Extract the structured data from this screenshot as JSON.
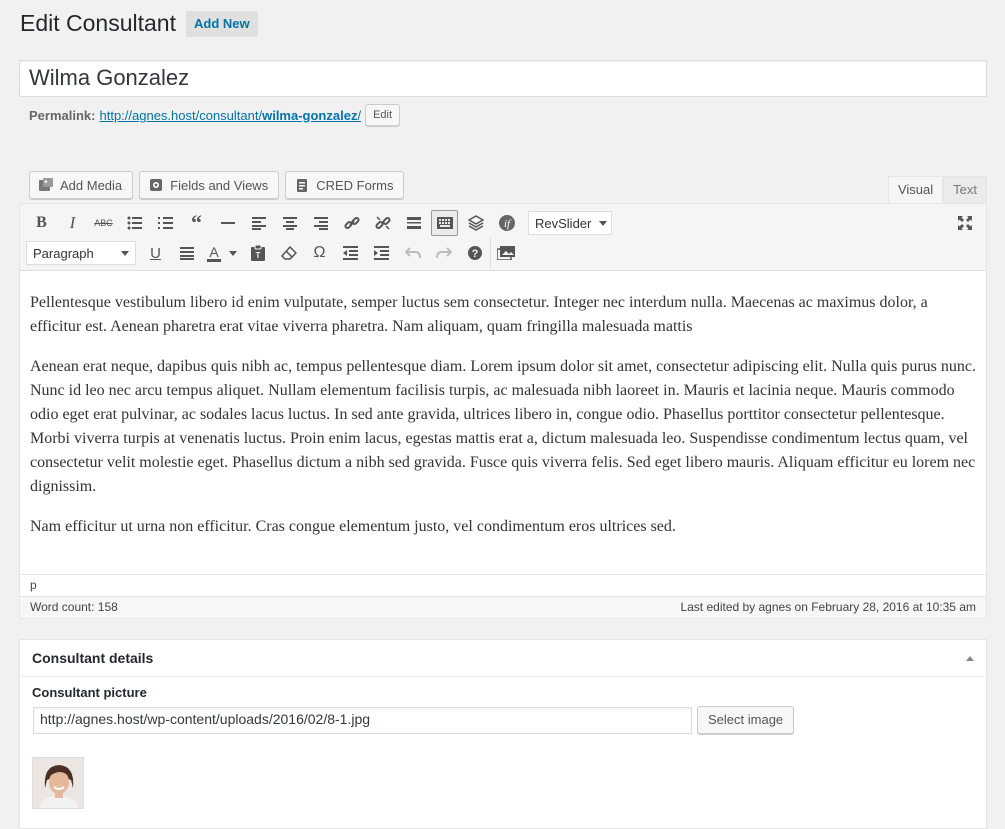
{
  "header": {
    "title": "Edit Consultant",
    "add_new": "Add New"
  },
  "post": {
    "title": "Wilma Gonzalez",
    "permalink_label": "Permalink:",
    "permalink_base": "http://agnes.host/consultant/",
    "permalink_slug": "wilma-gonzalez",
    "permalink_trailing": "/",
    "edit_label": "Edit"
  },
  "media_buttons": [
    {
      "label": "Add Media",
      "icon": "add-media-icon"
    },
    {
      "label": "Fields and Views",
      "icon": "fields-views-icon"
    },
    {
      "label": "CRED Forms",
      "icon": "cred-forms-icon"
    }
  ],
  "tabs": {
    "visual": "Visual",
    "text": "Text"
  },
  "toolbar": {
    "row1": [
      "bold-icon",
      "italic-icon",
      "strikethrough-icon",
      "bullet-list-icon",
      "numbered-list-icon",
      "blockquote-icon",
      "horizontal-rule-icon",
      "align-left-icon",
      "align-center-icon",
      "align-right-icon",
      "link-icon",
      "unlink-icon",
      "read-more-icon",
      "toolbar-toggle-icon",
      "layers-icon",
      "formula-icon"
    ],
    "revslider": "RevSlider",
    "format_select": "Paragraph",
    "row2": [
      "underline-icon",
      "justify-icon",
      "text-color-icon",
      "paste-text-icon",
      "clear-formatting-icon",
      "special-character-icon",
      "outdent-icon",
      "indent-icon",
      "undo-icon",
      "redo-icon",
      "help-icon",
      "gallery-icon"
    ]
  },
  "content": {
    "paragraphs": [
      "Pellentesque vestibulum libero id enim vulputate, semper luctus sem consectetur. Integer nec interdum nulla. Maecenas ac maximus dolor, a efficitur est. Aenean pharetra erat vitae viverra pharetra. Nam aliquam, quam fringilla malesuada mattis",
      "Aenean erat neque, dapibus quis nibh ac, tempus pellentesque diam. Lorem ipsum dolor sit amet, consectetur adipiscing elit. Nulla quis purus nunc. Nunc id leo nec arcu tempus aliquet. Nullam elementum facilisis turpis, ac malesuada nibh laoreet in. Mauris et lacinia neque. Mauris commodo odio eget erat pulvinar, ac sodales lacus luctus. In sed ante gravida, ultrices libero in, congue odio. Phasellus porttitor consectetur pellentesque. Morbi viverra turpis at venenatis luctus. Proin enim lacus, egestas mattis erat a, dictum malesuada leo. Suspendisse condimentum lectus quam, vel consectetur velit molestie eget. Phasellus dictum a nibh sed gravida. Fusce quis viverra felis. Sed eget libero mauris. Aliquam efficitur eu lorem nec dignissim.",
      "Nam efficitur ut urna non efficitur. Cras congue elementum justo, vel condimentum eros ultrices sed."
    ],
    "path": "p",
    "word_count": "Word count: 158",
    "last_edited": "Last edited by agnes on February 28, 2016 at 10:35 am"
  },
  "metabox": {
    "title": "Consultant details",
    "picture_label": "Consultant picture",
    "picture_url": "http://agnes.host/wp-content/uploads/2016/02/8-1.jpg",
    "select_image": "Select image"
  },
  "colors": {
    "link": "#0073aa",
    "background": "#f1f1f1"
  }
}
